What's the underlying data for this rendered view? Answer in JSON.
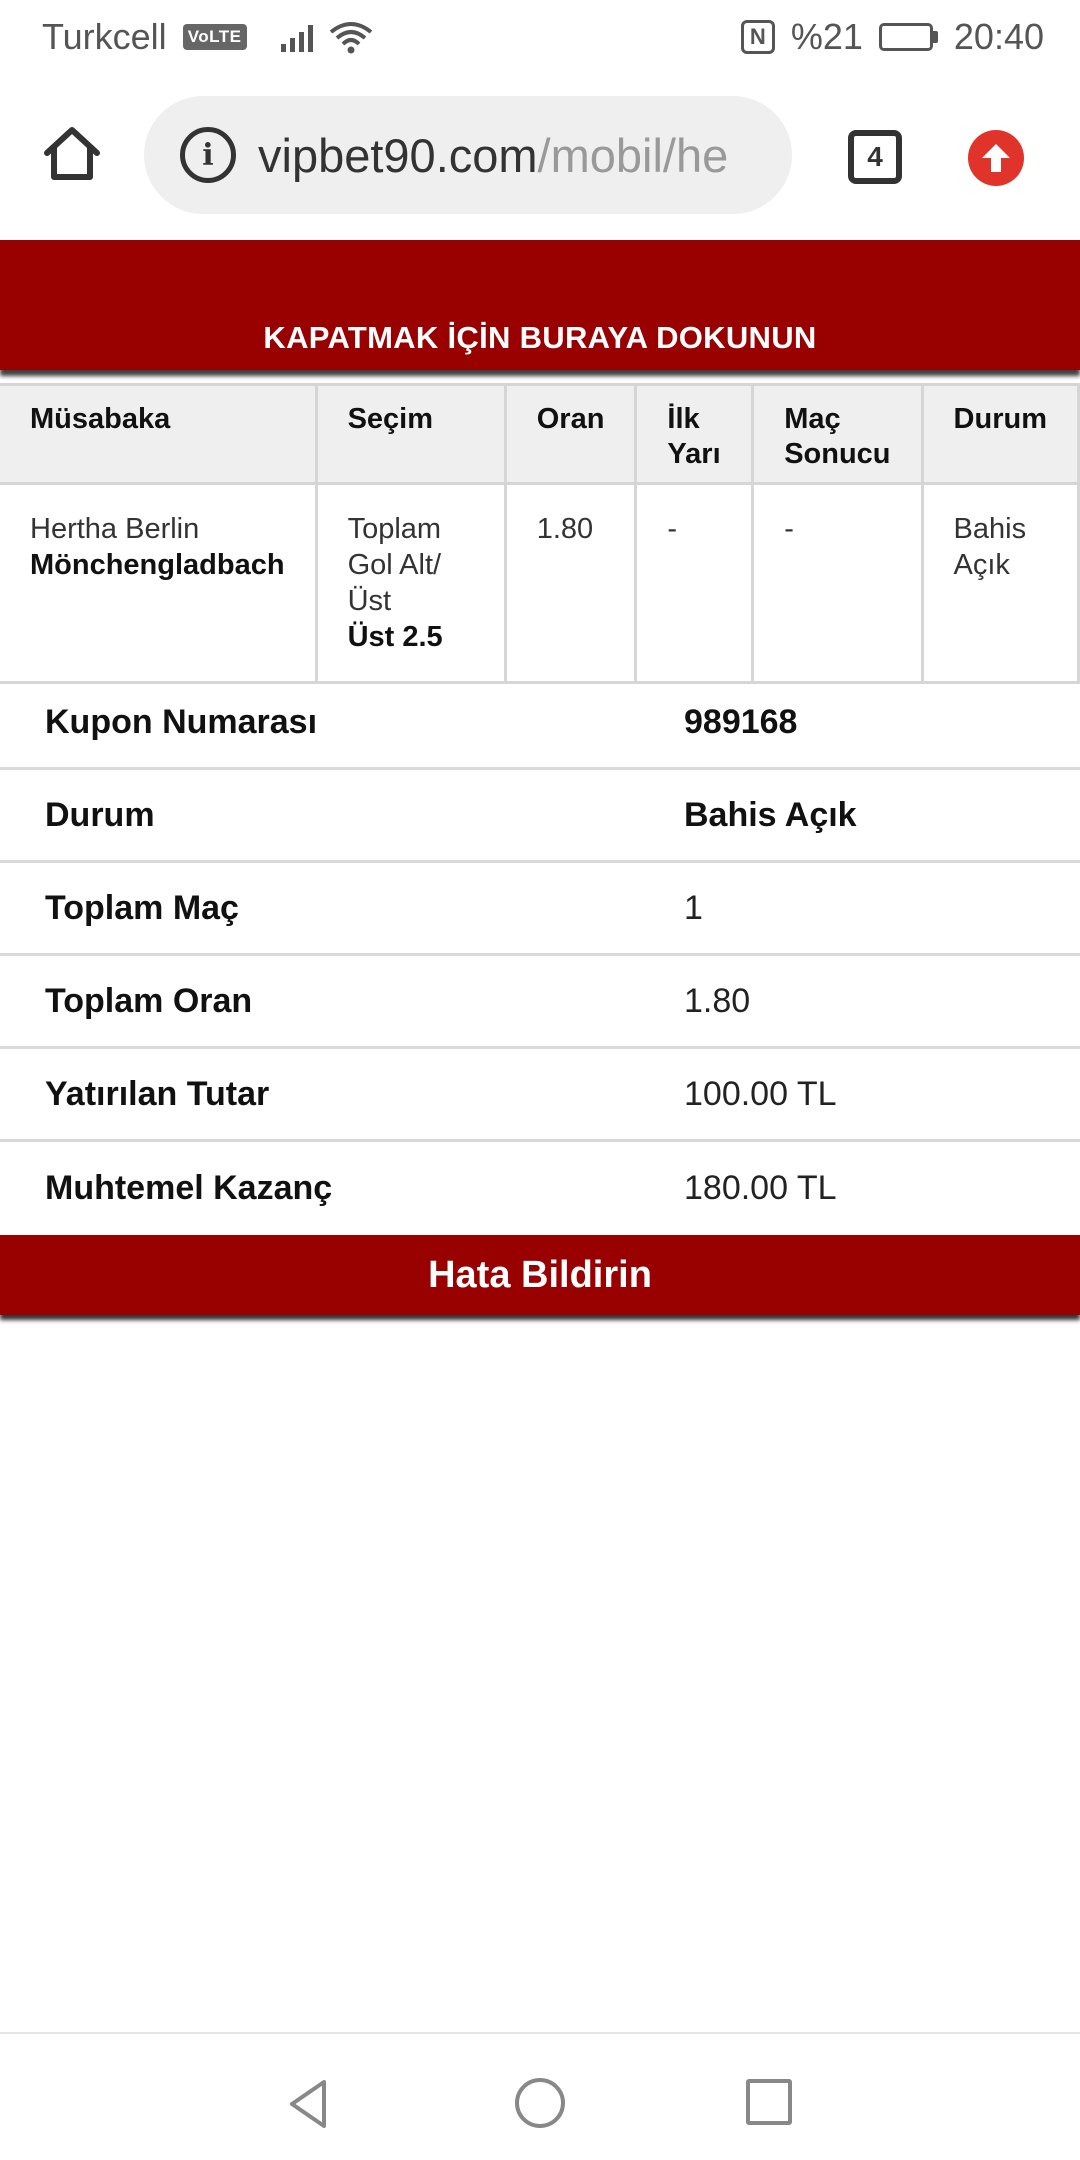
{
  "status_bar": {
    "carrier": "Turkcell",
    "volte": "VoLTE",
    "nfc": "N",
    "battery_percent": "%21",
    "battery_level": 0.21,
    "time": "20:40"
  },
  "browser": {
    "url_domain": "vipbet90.com",
    "url_path": "/mobil/he",
    "tab_count": "4",
    "icons": [
      "home-icon",
      "info-icon",
      "tabs-icon",
      "update-arrow-icon"
    ],
    "update_color": "#e0342a"
  },
  "banner": {
    "text": "KAPATMAK İÇİN BURAYA DOKUNUN",
    "color": "#990000"
  },
  "bet_table": {
    "headers": [
      "Müsabaka",
      "Seçim",
      "Oran",
      "İlk Yarı",
      "Maç Sonucu",
      "Durum"
    ],
    "header_lines": {
      "ilk_yari": [
        "İlk",
        "Yarı"
      ],
      "mac_sonucu": [
        "Maç",
        "Sonucu"
      ]
    },
    "row": {
      "home_team": "Hertha Berlin",
      "away_team": "Mönchengladbach",
      "selection_lines": [
        "Toplam",
        "Gol Alt/",
        "Üst"
      ],
      "selection_value": "Üst 2.5",
      "odds": "1.80",
      "first_half": "-",
      "match_result": "-",
      "status_lines": [
        "Bahis",
        "Açık"
      ]
    }
  },
  "summary": [
    {
      "label": "Kupon Numarası",
      "value": "989168"
    },
    {
      "label": "Durum",
      "value": "Bahis Açık"
    },
    {
      "label": "Toplam Maç",
      "value": "1"
    },
    {
      "label": "Toplam Oran",
      "value": "1.80"
    },
    {
      "label": "Yatırılan Tutar",
      "value": "100.00 TL"
    },
    {
      "label": "Muhtemel Kazanç",
      "value": "180.00 TL"
    }
  ],
  "report_button": {
    "label": "Hata Bildirin"
  },
  "nav": {
    "icons": [
      "back-icon",
      "home-circle-icon",
      "recent-apps-icon"
    ]
  }
}
